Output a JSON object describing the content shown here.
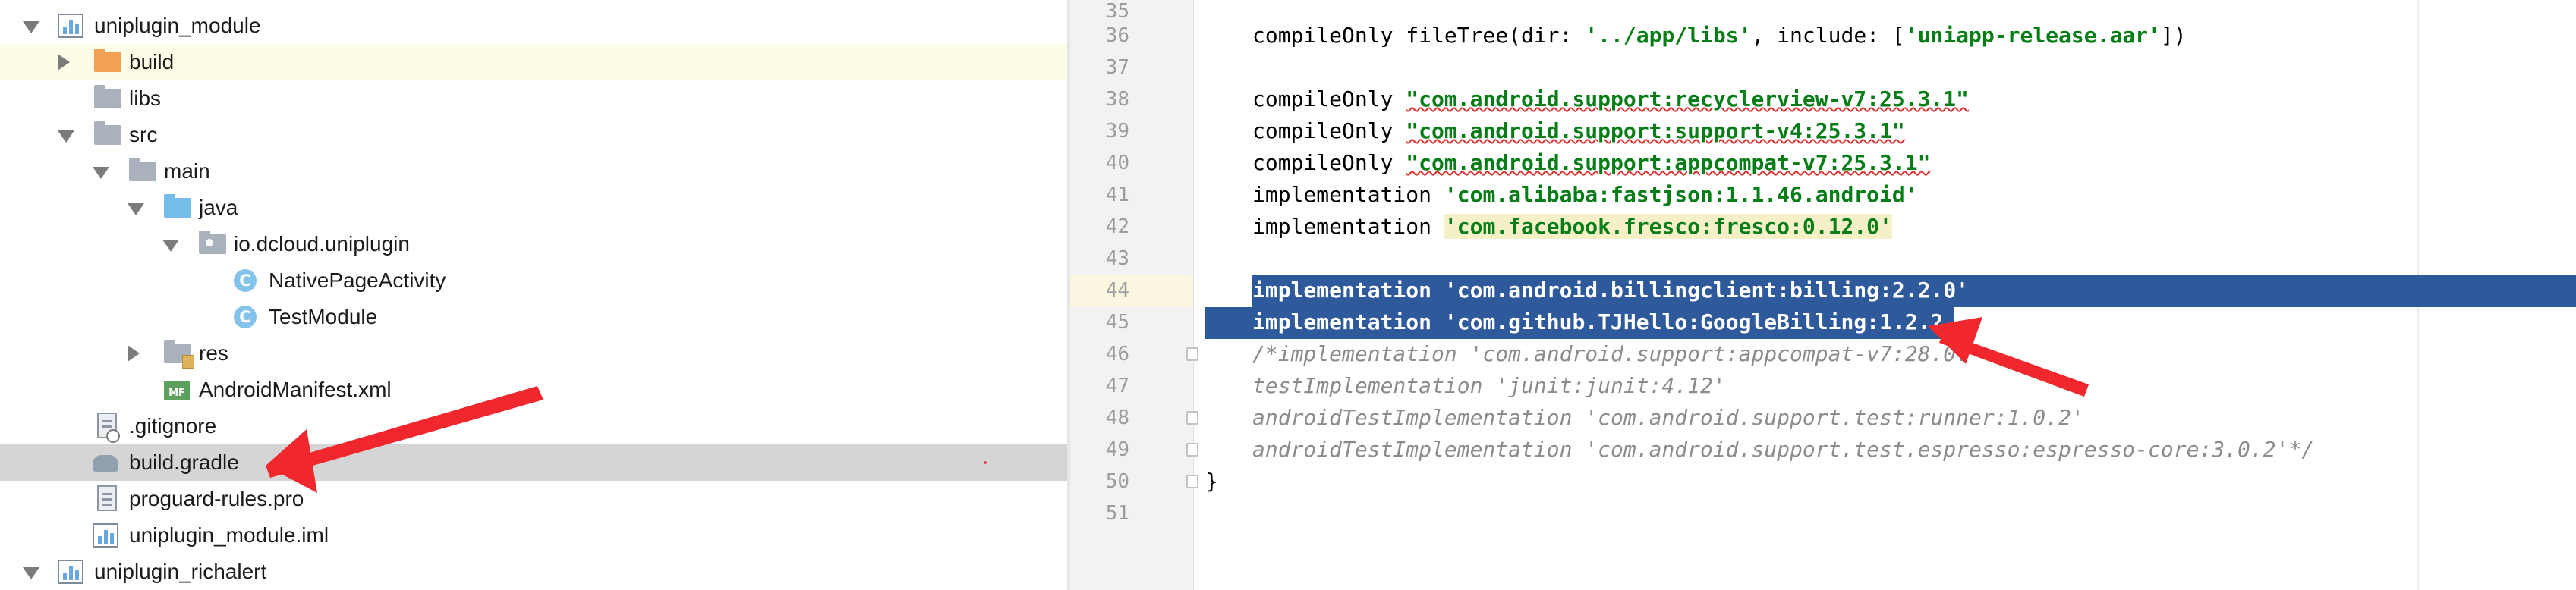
{
  "tree": {
    "items": [
      {
        "label": "uniplugin_module",
        "kind": "module",
        "expanded": true
      },
      {
        "label": "build",
        "kind": "folder-orange",
        "expanded": false
      },
      {
        "label": "libs",
        "kind": "folder"
      },
      {
        "label": "src",
        "kind": "folder",
        "expanded": true
      },
      {
        "label": "main",
        "kind": "folder",
        "expanded": true
      },
      {
        "label": "java",
        "kind": "folder-blue",
        "expanded": true
      },
      {
        "label": "io.dcloud.uniplugin",
        "kind": "package",
        "expanded": true
      },
      {
        "label": "NativePageActivity",
        "kind": "class"
      },
      {
        "label": "TestModule",
        "kind": "class"
      },
      {
        "label": "res",
        "kind": "res-folder",
        "expanded": false
      },
      {
        "label": "AndroidManifest.xml",
        "kind": "manifest"
      },
      {
        "label": ".gitignore",
        "kind": "file"
      },
      {
        "label": "build.gradle",
        "kind": "gradle",
        "selected": true
      },
      {
        "label": "proguard-rules.pro",
        "kind": "file"
      },
      {
        "label": "uniplugin_module.iml",
        "kind": "module"
      },
      {
        "label": "uniplugin_richalert",
        "kind": "module",
        "expanded": true
      }
    ]
  },
  "editor": {
    "line_numbers": [
      "35",
      "36",
      "37",
      "38",
      "39",
      "40",
      "41",
      "42",
      "43",
      "44",
      "45",
      "46",
      "47",
      "48",
      "49",
      "50",
      "51"
    ],
    "lines": {
      "l36_a": "compileOnly fileTree(dir: ",
      "l36_s1": "'../app/libs'",
      "l36_b": ", include: [",
      "l36_s2": "'uniapp-release.aar'",
      "l36_c": "])",
      "l38_a": "compileOnly ",
      "l38_s": "\"com.android.support:recyclerview-v7:25.3.1\"",
      "l39_a": "compileOnly ",
      "l39_s": "\"com.android.support:support-v4:25.3.1\"",
      "l40_a": "compileOnly ",
      "l40_s": "\"com.android.support:appcompat-v7:25.3.1\"",
      "l41_a": "implementation ",
      "l41_s": "'com.alibaba:fastjson:1.1.46.android'",
      "l42_a": "implementation ",
      "l42_s": "'com.facebook.fresco:fresco:0.12.0'",
      "l44_a": "implementation ",
      "l44_s": "'com.android.billingclient:billing:2.2.0'",
      "l45_a": "implementation ",
      "l45_s": "'com.github.TJHello:GoogleBilling:1.2.2.12'",
      "l46": "/*implementation 'com.android.support:appcompat-v7:28.0.",
      "l47": "testImplementation 'junit:junit:4.12'",
      "l48": "androidTestImplementation 'com.android.support.test:runner:1.0.2'",
      "l49": "androidTestImplementation 'com.android.support.test.espresso:espresso-core:3.0.2'*/",
      "l50": "}"
    }
  },
  "colors": {
    "selection": "#2e5a9b",
    "string": "#067d17",
    "comment": "#8c8c8c",
    "annotation_arrow": "#f0282d",
    "tree_highlight": "#fdfde7",
    "tree_selected": "#d5d5d5"
  },
  "icons": [
    "expand-arrow-icon",
    "collapse-arrow-icon",
    "folder-icon",
    "module-icon",
    "class-icon",
    "manifest-icon",
    "gradle-icon",
    "file-icon",
    "fold-marker-icon"
  ]
}
